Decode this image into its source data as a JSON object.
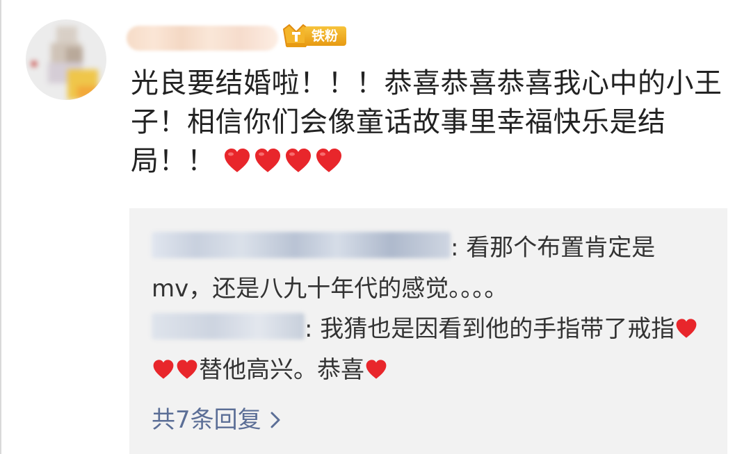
{
  "comment": {
    "text": "光良要结婚啦！！！恭喜恭喜恭喜我心中的小王子！相信你们会像童话故事里幸福快乐是结局！！",
    "heart_count": 4,
    "heart_color": "#e8262b"
  },
  "badge": {
    "label": "铁粉",
    "icon": "crown-icon",
    "color": "#f0a81f"
  },
  "replies": [
    {
      "text": ": 看那个布置肯定是mv，还是八九十年代的感觉。。。。"
    },
    {
      "text_before": ": 我猜也是因看到他的手指带了戒指",
      "text_middle": "替他高兴。恭喜"
    }
  ],
  "more_replies": {
    "label": "共7条回复",
    "color": "#5b6e96"
  },
  "colors": {
    "reply_bg": "#f2f2f2",
    "text": "#222222"
  }
}
